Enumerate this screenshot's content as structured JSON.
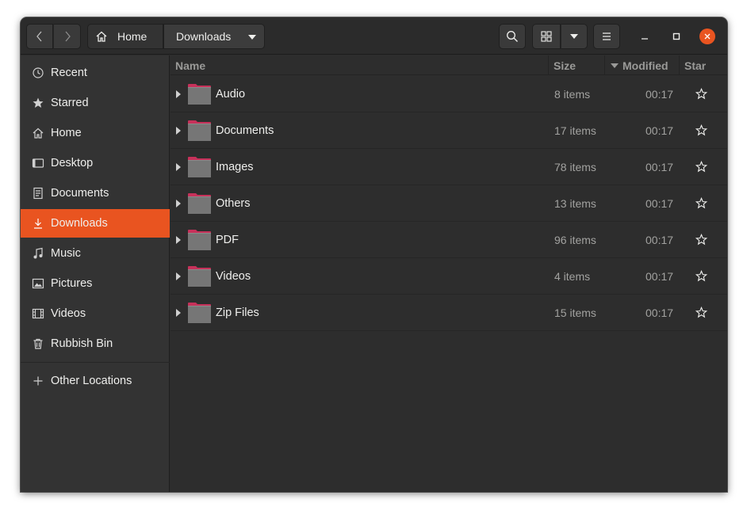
{
  "header": {
    "breadcrumb_home": "Home",
    "breadcrumb_current": "Downloads"
  },
  "sidebar": {
    "items": [
      {
        "label": "Recent",
        "icon": "clock-icon"
      },
      {
        "label": "Starred",
        "icon": "star-icon"
      },
      {
        "label": "Home",
        "icon": "home-icon"
      },
      {
        "label": "Desktop",
        "icon": "desktop-icon"
      },
      {
        "label": "Documents",
        "icon": "document-icon"
      },
      {
        "label": "Downloads",
        "icon": "download-icon",
        "active": true
      },
      {
        "label": "Music",
        "icon": "music-icon"
      },
      {
        "label": "Pictures",
        "icon": "picture-icon"
      },
      {
        "label": "Videos",
        "icon": "film-icon"
      },
      {
        "label": "Rubbish Bin",
        "icon": "trash-icon"
      }
    ],
    "other_locations": "Other Locations"
  },
  "columns": {
    "name": "Name",
    "size": "Size",
    "modified": "Modified",
    "star": "Star"
  },
  "files": [
    {
      "name": "Audio",
      "size": "8 items",
      "modified": "00:17"
    },
    {
      "name": "Documents",
      "size": "17 items",
      "modified": "00:17"
    },
    {
      "name": "Images",
      "size": "78 items",
      "modified": "00:17"
    },
    {
      "name": "Others",
      "size": "13 items",
      "modified": "00:17"
    },
    {
      "name": "PDF",
      "size": "96 items",
      "modified": "00:17"
    },
    {
      "name": "Videos",
      "size": "4 items",
      "modified": "00:17"
    },
    {
      "name": "Zip Files",
      "size": "15 items",
      "modified": "00:17"
    }
  ],
  "colors": {
    "accent": "#e95420",
    "window_bg": "#2d2d2d",
    "sidebar_bg": "#333333",
    "folder_tab": "#c7315a"
  }
}
